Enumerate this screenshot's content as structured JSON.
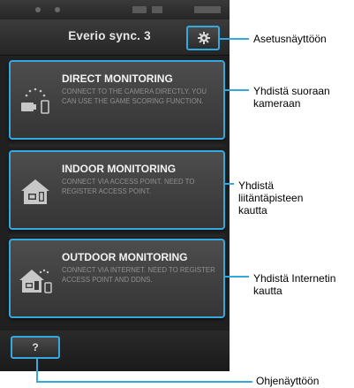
{
  "app": {
    "title": "Everio sync. 3"
  },
  "settings": {
    "icon": "gear-icon"
  },
  "cards": [
    {
      "title": "DIRECT MONITORING",
      "description": "CONNECT TO THE CAMERA DIRECTLY. YOU CAN USE THE GAME SCORING FUNCTION.",
      "icon": "direct-camera-icon"
    },
    {
      "title": "INDOOR MONITORING",
      "description": "CONNECT VIA ACCESS POINT. NEED TO REGISTER ACCESS POINT.",
      "icon": "house-icon"
    },
    {
      "title": "OUTDOOR MONITORING",
      "description": "CONNECT VIA INTERNET. NEED TO REGISTER ACCESS POINT AND DDNS.",
      "icon": "house-wifi-icon"
    }
  ],
  "help": {
    "label": "?"
  },
  "annotations": {
    "settings": "Asetusnäyttöön",
    "direct": "Yhdistä suoraan kameraan",
    "indoor": "Yhdistä liitäntäpisteen kautta",
    "outdoor": "Yhdistä Internetin kautta",
    "help": "Ohjenäyttöön"
  },
  "colors": {
    "accent": "#35a8e0",
    "background": "#1c1c1c"
  }
}
